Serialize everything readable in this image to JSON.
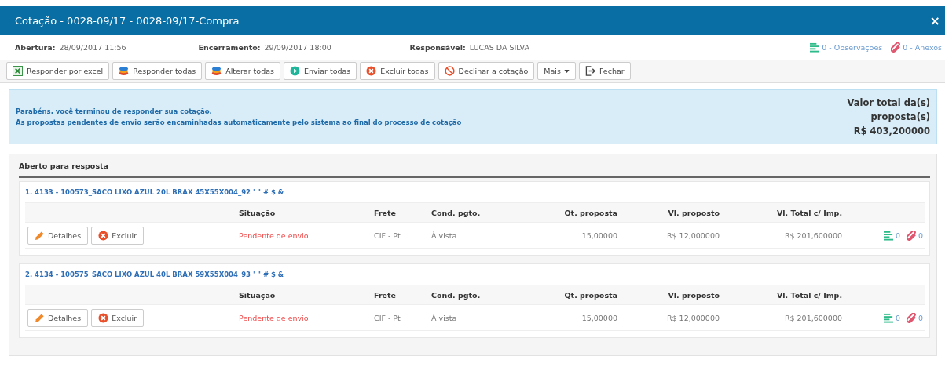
{
  "window": {
    "title": "Cotação - 0028-09/17 - 0028-09/17-Compra",
    "close": "×"
  },
  "info": {
    "abertura_label": "Abertura:",
    "abertura": "28/09/2017 11:56",
    "encerramento_label": "Encerramento:",
    "encerramento": "29/09/2017 18:00",
    "responsavel_label": "Responsável:",
    "responsavel": "LUCAS DA SILVA",
    "observacoes": "0 - Observações",
    "anexos": "0 - Anexos"
  },
  "toolbar": [
    {
      "label": "Responder por excel",
      "kind": "excel"
    },
    {
      "label": "Responder todas",
      "kind": "stack"
    },
    {
      "label": "Alterar todas",
      "kind": "stack"
    },
    {
      "label": "Enviar todas",
      "kind": "play"
    },
    {
      "label": "Excluir todas",
      "kind": "delete"
    },
    {
      "label": "Declinar a cotação",
      "kind": "ban"
    },
    {
      "label": "Mais",
      "kind": "dropdown"
    },
    {
      "label": "Fechar",
      "kind": "exit"
    }
  ],
  "alert": {
    "lines": [
      "Parabéns, você terminou de responder sua cotação.",
      "As propostas pendentes de envio serão encaminhadas automaticamente pelo sistema ao final do processo de cotação"
    ],
    "total_label": "Valor total da(s) proposta(s)",
    "total": "R$ 403,200000"
  },
  "section": {
    "title": "Aberto para resposta"
  },
  "items": [
    {
      "title": "1. 4133 - 100573_SACO LIXO AZUL 20L BRAX 45X55X004_92 ' \" # $ &",
      "columns": [
        "Situação",
        "Frete",
        "Cond. pgto.",
        "Qt. proposta",
        "Vl. proposto",
        "Vl. Total c/ Imp."
      ],
      "details": "Detalhes",
      "delete": "Excluir",
      "situacao": "Pendente de envio",
      "frete": "CIF - Pt",
      "cond": "À vista",
      "qt": "15,00000",
      "vl": "R$ 12,000000",
      "total": "R$ 201,600000",
      "obs": "0",
      "anexos": "0"
    },
    {
      "title": "2. 4134 - 100575_SACO LIXO AZUL 40L BRAX 59X55X004_93 ' \" # $ &",
      "columns": [
        "Situação",
        "Frete",
        "Cond. pgto.",
        "Qt. proposta",
        "Vl. proposto",
        "Vl. Total c/ Imp."
      ],
      "details": "Detalhes",
      "delete": "Excluir",
      "situacao": "Pendente de envio",
      "frete": "CIF - Pt",
      "cond": "À vista",
      "qt": "15,00000",
      "vl": "R$ 12,000000",
      "total": "R$ 201,600000",
      "obs": "0",
      "anexos": "0"
    }
  ]
}
